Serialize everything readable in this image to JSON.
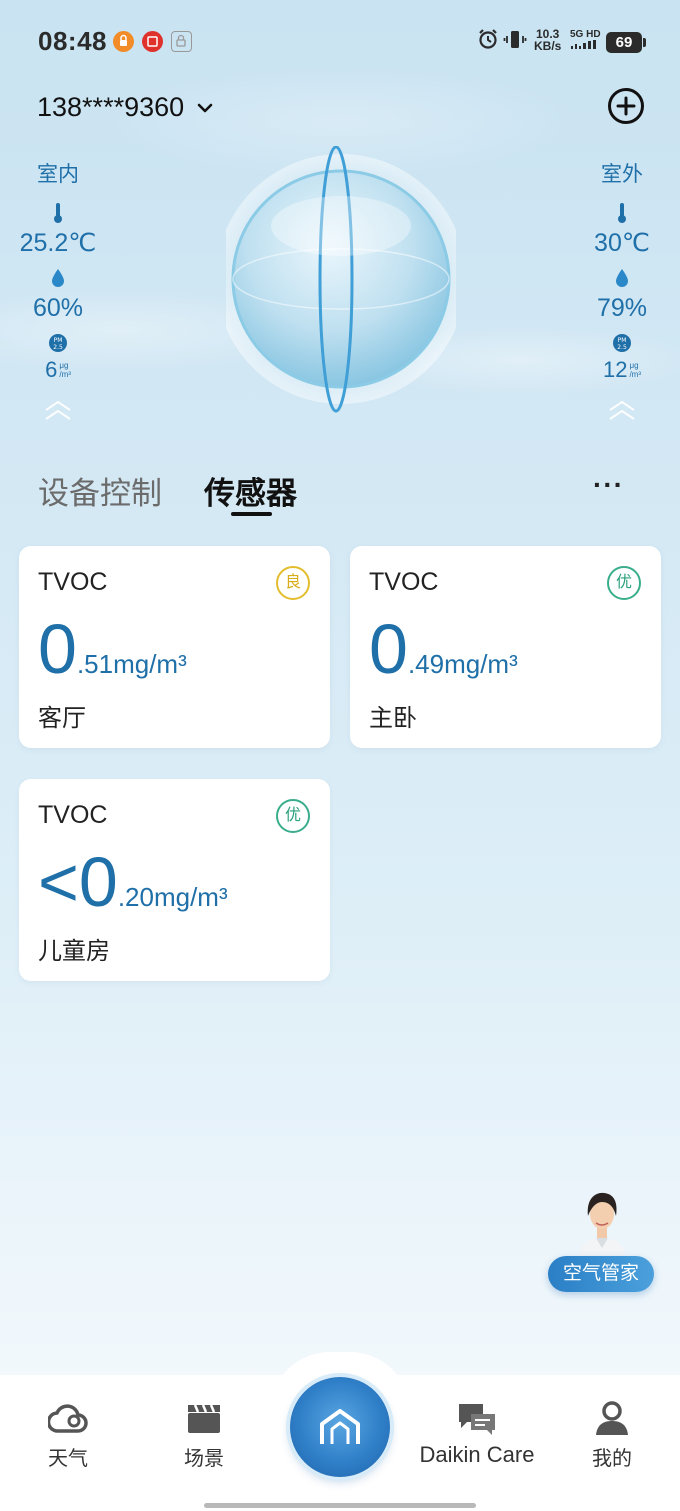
{
  "status_bar": {
    "time": "08:48",
    "net_speed_value": "10.3",
    "net_speed_unit": "KB/s",
    "signal_label_top": "5G HD",
    "battery": "69"
  },
  "header": {
    "account": "138****9360"
  },
  "indoor": {
    "label": "室内",
    "temperature": "25.2℃",
    "humidity": "60%",
    "pm25": "6",
    "pm_unit_top": "μg",
    "pm_unit_bottom": "/m³"
  },
  "outdoor": {
    "label": "室外",
    "temperature": "30℃",
    "humidity": "79%",
    "pm25": "12",
    "pm_unit_top": "μg",
    "pm_unit_bottom": "/m³"
  },
  "tabs": {
    "device_control": "设备控制",
    "sensor": "传感器",
    "more": "···"
  },
  "cards": [
    {
      "title": "TVOC",
      "badge": "良",
      "reading_big": "0",
      "reading_small": ".51mg/m³",
      "room": "客厅"
    },
    {
      "title": "TVOC",
      "badge": "优",
      "reading_big": "0",
      "reading_small": ".49mg/m³",
      "room": "主卧"
    },
    {
      "title": "TVOC",
      "badge": "优",
      "reading_big": "<0",
      "reading_small": ".20mg/m³",
      "room": "儿童房"
    }
  ],
  "assistant": {
    "label": "空气管家"
  },
  "bottom_nav": {
    "weather": "天气",
    "scene": "场景",
    "daikin_care": "Daikin Care",
    "mine": "我的"
  },
  "colors": {
    "accent_blue": "#1f6fa8",
    "badge_good": "#e3bd2e",
    "badge_excellent": "#3aae8c"
  }
}
